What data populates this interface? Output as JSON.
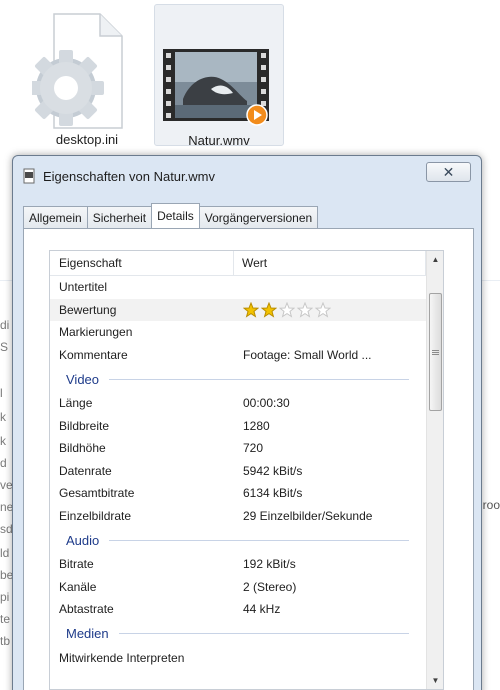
{
  "desktop": {
    "files": [
      {
        "name": "desktop.ini",
        "icon": "settings-file-icon"
      },
      {
        "name": "Natur.wmv",
        "icon": "video-file-icon",
        "selected": true
      }
    ],
    "background_fragments": [
      "di",
      "S",
      "l",
      "k",
      "k",
      "d",
      "ve",
      "ne",
      "sd",
      "ld",
      "be",
      "pi",
      "te",
      "tb"
    ],
    "background_right": "roo"
  },
  "window": {
    "title": "Eigenschaften von Natur.wmv",
    "close_label": "✕",
    "tabs": [
      {
        "label": "Allgemein",
        "active": false
      },
      {
        "label": "Sicherheit",
        "active": false
      },
      {
        "label": "Details",
        "active": true
      },
      {
        "label": "Vorgängerversionen",
        "active": false
      }
    ],
    "list": {
      "header": {
        "property": "Eigenschaft",
        "value": "Wert"
      },
      "rows_top": [
        {
          "key": "Untertitel",
          "value": ""
        },
        {
          "key": "Bewertung",
          "value": "",
          "stars": 2,
          "stars_max": 5
        },
        {
          "key": "Markierungen",
          "value": ""
        },
        {
          "key": "Kommentare",
          "value": "Footage: Small World ..."
        }
      ],
      "video_label": "Video",
      "rows_video": [
        {
          "key": "Länge",
          "value": "00:00:30"
        },
        {
          "key": "Bildbreite",
          "value": "1280"
        },
        {
          "key": "Bildhöhe",
          "value": "720"
        },
        {
          "key": "Datenrate",
          "value": "5942 kBit/s"
        },
        {
          "key": "Gesamtbitrate",
          "value": "6134 kBit/s"
        },
        {
          "key": "Einzelbildrate",
          "value": "29 Einzelbilder/Sekunde"
        }
      ],
      "audio_label": "Audio",
      "rows_audio": [
        {
          "key": "Bitrate",
          "value": "192 kBit/s"
        },
        {
          "key": "Kanäle",
          "value": "2 (Stereo)"
        },
        {
          "key": "Abtastrate",
          "value": "44 kHz"
        }
      ],
      "media_label": "Medien",
      "rows_media": [
        {
          "key": "Mitwirkende Interpreten",
          "value": ""
        }
      ]
    }
  },
  "colors": {
    "star": "#f2c200",
    "section": "#1e3b8a"
  }
}
